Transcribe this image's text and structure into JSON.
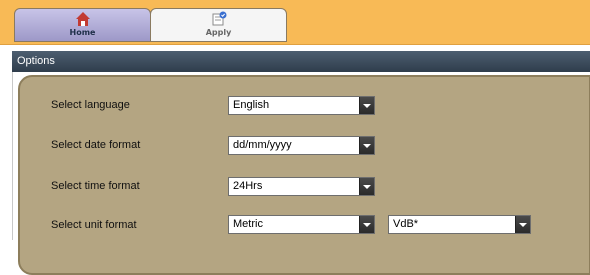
{
  "toolbar": {
    "tabs": [
      {
        "label": "Home",
        "icon": "home-icon"
      },
      {
        "label": "Apply",
        "icon": "apply-icon"
      }
    ]
  },
  "options": {
    "header": "Options",
    "rows": [
      {
        "label": "Select language",
        "value": "English"
      },
      {
        "label": "Select date format",
        "value": "dd/mm/yyyy"
      },
      {
        "label": "Select time format",
        "value": "24Hrs"
      },
      {
        "label": "Select unit format",
        "value": "Metric",
        "secondary_value": "VdB*"
      }
    ]
  },
  "colors": {
    "topbar": "#f8ba56",
    "options_bg": "#b4a582",
    "header_bg": "#3d4c5c"
  }
}
